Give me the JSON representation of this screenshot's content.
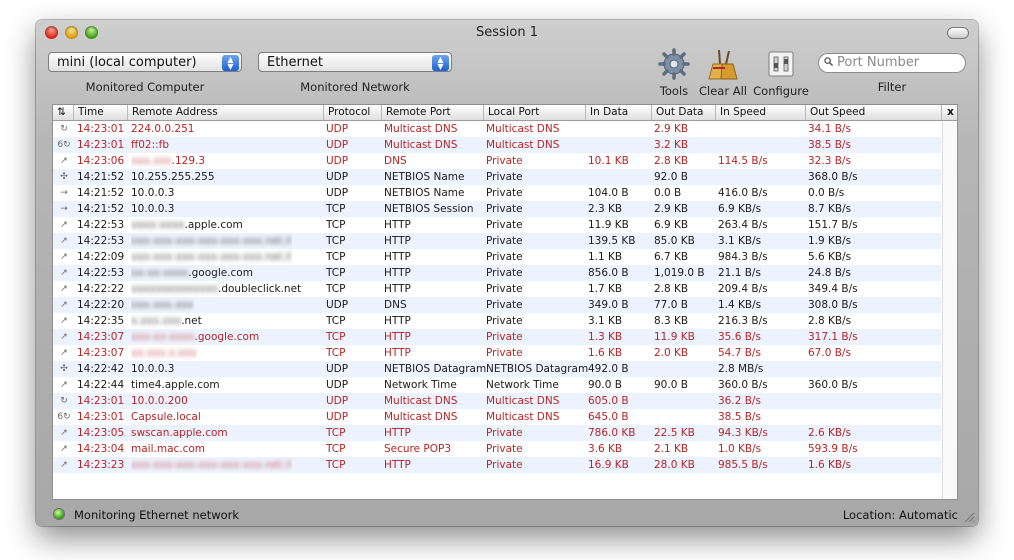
{
  "window": {
    "title": "Session 1"
  },
  "toolbar": {
    "computer": {
      "value": "mini (local computer)",
      "label": "Monitored Computer"
    },
    "network": {
      "value": "Ethernet",
      "label": "Monitored Network"
    },
    "tools_label": "Tools",
    "clear_all_label": "Clear All",
    "configure_label": "Configure",
    "filter": {
      "placeholder": "Port Number",
      "label": "Filter"
    }
  },
  "table": {
    "columns": [
      "Time",
      "Remote Address",
      "Protocol",
      "Remote Port",
      "Local Port",
      "In Data",
      "Out Data",
      "In Speed",
      "Out Speed"
    ],
    "close_label": "x",
    "rows": [
      {
        "dir": "↻",
        "time": "14:23:01",
        "addr_pre": "",
        "addr": "224.0.0.251",
        "proto": "UDP",
        "rport": "Multicast DNS",
        "lport": "Multicast DNS",
        "in_data": "",
        "out_data": "2.9 KB",
        "in_speed": "",
        "out_speed": "34.1 B/s",
        "red": true
      },
      {
        "dir": "6↻",
        "time": "14:23:01",
        "addr_pre": "",
        "addr": "ff02::fb",
        "proto": "UDP",
        "rport": "Multicast DNS",
        "lport": "Multicast DNS",
        "in_data": "",
        "out_data": "3.2 KB",
        "in_speed": "",
        "out_speed": "38.5 B/s",
        "red": true
      },
      {
        "dir": "↗",
        "time": "14:23:06",
        "addr_pre": "xxx.xxx",
        "addr": ".129.3",
        "proto": "UDP",
        "rport": "DNS",
        "lport": "Private",
        "in_data": "10.1 KB",
        "out_data": "2.8 KB",
        "in_speed": "114.5 B/s",
        "out_speed": "32.3 B/s",
        "red": true
      },
      {
        "dir": "✣",
        "time": "14:21:52",
        "addr_pre": "",
        "addr": "10.255.255.255",
        "proto": "UDP",
        "rport": "NETBIOS Name",
        "lport": "Private",
        "in_data": "",
        "out_data": "92.0 B",
        "in_speed": "",
        "out_speed": "368.0 B/s",
        "red": false
      },
      {
        "dir": "→",
        "time": "14:21:52",
        "addr_pre": "",
        "addr": "10.0.0.3",
        "proto": "UDP",
        "rport": "NETBIOS Name",
        "lport": "Private",
        "in_data": "104.0 B",
        "out_data": "0.0 B",
        "in_speed": "416.0 B/s",
        "out_speed": "0.0 B/s",
        "red": false
      },
      {
        "dir": "→",
        "time": "14:21:52",
        "addr_pre": "",
        "addr": "10.0.0.3",
        "proto": "TCP",
        "rport": "NETBIOS Session",
        "lport": "Private",
        "in_data": "2.3 KB",
        "out_data": "2.9 KB",
        "in_speed": "6.9 KB/s",
        "out_speed": "8.7 KB/s",
        "red": false
      },
      {
        "dir": "↗",
        "time": "14:22:53",
        "addr_pre": "xxxx-xxxx",
        "addr": ".apple.com",
        "proto": "TCP",
        "rport": "HTTP",
        "lport": "Private",
        "in_data": "11.9 KB",
        "out_data": "6.9 KB",
        "in_speed": "263.4 B/s",
        "out_speed": "151.7 B/s",
        "red": false
      },
      {
        "dir": "↗",
        "time": "14:22:53",
        "addr_pre": "xxx-xxx-xxx-xxx-xxx-xxx.net.il",
        "addr": "",
        "proto": "TCP",
        "rport": "HTTP",
        "lport": "Private",
        "in_data": "139.5 KB",
        "out_data": "85.0 KB",
        "in_speed": "3.1 KB/s",
        "out_speed": "1.9 KB/s",
        "red": false
      },
      {
        "dir": "↗",
        "time": "14:22:09",
        "addr_pre": "xxx-xxx-xxx-xxx-xxx-xxx.net.il",
        "addr": "",
        "proto": "TCP",
        "rport": "HTTP",
        "lport": "Private",
        "in_data": "1.1 KB",
        "out_data": "6.7 KB",
        "in_speed": "984.3 B/s",
        "out_speed": "5.6 KB/s",
        "red": false
      },
      {
        "dir": "↗",
        "time": "14:22:53",
        "addr_pre": "xx-xx-xxxx",
        "addr": ".google.com",
        "proto": "TCP",
        "rport": "HTTP",
        "lport": "Private",
        "in_data": "856.0 B",
        "out_data": "1,019.0 B",
        "in_speed": "21.1 B/s",
        "out_speed": "24.8 B/s",
        "red": false
      },
      {
        "dir": "↗",
        "time": "14:22:22",
        "addr_pre": "xxxxxxxxxxxxxx",
        "addr": ".doubleclick.net",
        "proto": "TCP",
        "rport": "HTTP",
        "lport": "Private",
        "in_data": "1.7 KB",
        "out_data": "2.8 KB",
        "in_speed": "209.4 B/s",
        "out_speed": "349.4 B/s",
        "red": false
      },
      {
        "dir": "↗",
        "time": "14:22:20",
        "addr_pre": "xxx.xxx.xxx",
        "addr": "",
        "proto": "UDP",
        "rport": "DNS",
        "lport": "Private",
        "in_data": "349.0 B",
        "out_data": "77.0 B",
        "in_speed": "1.4 KB/s",
        "out_speed": "308.0 B/s",
        "red": false
      },
      {
        "dir": "↗",
        "time": "14:22:35",
        "addr_pre": "x.xxx.xxx",
        "addr": ".net",
        "proto": "TCP",
        "rport": "HTTP",
        "lport": "Private",
        "in_data": "3.1 KB",
        "out_data": "8.3 KB",
        "in_speed": "216.3 B/s",
        "out_speed": "2.8 KB/s",
        "red": false
      },
      {
        "dir": "↗",
        "time": "14:23:07",
        "addr_pre": "xxx-xx-xxxx",
        "addr": ".google.com",
        "proto": "TCP",
        "rport": "HTTP",
        "lport": "Private",
        "in_data": "1.3 KB",
        "out_data": "11.9 KB",
        "in_speed": "35.6 B/s",
        "out_speed": "317.1 B/s",
        "red": true
      },
      {
        "dir": "↗",
        "time": "14:23:07",
        "addr_pre": "xx.xxx.x.xxx",
        "addr": "",
        "proto": "TCP",
        "rport": "HTTP",
        "lport": "Private",
        "in_data": "1.6 KB",
        "out_data": "2.0 KB",
        "in_speed": "54.7 B/s",
        "out_speed": "67.0 B/s",
        "red": true
      },
      {
        "dir": "✣",
        "time": "14:22:42",
        "addr_pre": "",
        "addr": "10.0.0.3",
        "proto": "UDP",
        "rport": "NETBIOS Datagram",
        "lport": "NETBIOS Datagram",
        "in_data": "492.0 B",
        "out_data": "",
        "in_speed": "2.8 MB/s",
        "out_speed": "",
        "red": false
      },
      {
        "dir": "↗",
        "time": "14:22:44",
        "addr_pre": "",
        "addr": "time4.apple.com",
        "proto": "UDP",
        "rport": "Network Time",
        "lport": "Network Time",
        "in_data": "90.0 B",
        "out_data": "90.0 B",
        "in_speed": "360.0 B/s",
        "out_speed": "360.0 B/s",
        "red": false
      },
      {
        "dir": "↻",
        "time": "14:23:01",
        "addr_pre": "",
        "addr": "10.0.0.200",
        "proto": "UDP",
        "rport": "Multicast DNS",
        "lport": "Multicast DNS",
        "in_data": "605.0 B",
        "out_data": "",
        "in_speed": "36.2 B/s",
        "out_speed": "",
        "red": true
      },
      {
        "dir": "6↻",
        "time": "14:23:01",
        "addr_pre": "",
        "addr": "Capsule.local",
        "proto": "UDP",
        "rport": "Multicast DNS",
        "lport": "Multicast DNS",
        "in_data": "645.0 B",
        "out_data": "",
        "in_speed": "38.5 B/s",
        "out_speed": "",
        "red": true
      },
      {
        "dir": "↗",
        "time": "14:23:05",
        "addr_pre": "",
        "addr": "swscan.apple.com",
        "proto": "TCP",
        "rport": "HTTP",
        "lport": "Private",
        "in_data": "786.0 KB",
        "out_data": "22.5 KB",
        "in_speed": "94.3 KB/s",
        "out_speed": "2.6 KB/s",
        "red": true
      },
      {
        "dir": "↗",
        "time": "14:23:04",
        "addr_pre": "",
        "addr": "mail.mac.com",
        "proto": "TCP",
        "rport": "Secure POP3",
        "lport": "Private",
        "in_data": "3.6 KB",
        "out_data": "2.1 KB",
        "in_speed": "1.0 KB/s",
        "out_speed": "593.9 B/s",
        "red": true
      },
      {
        "dir": "↗",
        "time": "14:23:23",
        "addr_pre": "xxx-xxx-xxx-xxx-xxx-xxx.net.il",
        "addr": "",
        "proto": "TCP",
        "rport": "HTTP",
        "lport": "Private",
        "in_data": "16.9 KB",
        "out_data": "28.0 KB",
        "in_speed": "985.5 B/s",
        "out_speed": "1.6 KB/s",
        "red": true
      }
    ]
  },
  "status": {
    "text": "Monitoring Ethernet network",
    "location": "Location: Automatic"
  },
  "colors": {
    "active_row_text": "#b52525",
    "alt_row": "#edf3fe",
    "popup_arrow": "#1f5fcf"
  }
}
